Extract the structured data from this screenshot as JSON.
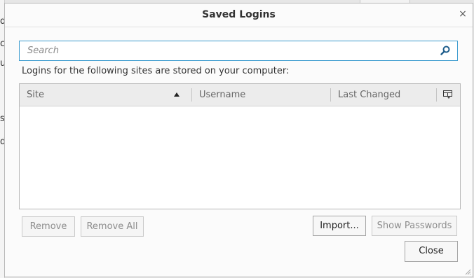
{
  "background": {
    "peek_chars": [
      "d",
      "c",
      "u",
      "s",
      "d"
    ]
  },
  "dialog": {
    "title": "Saved Logins",
    "close_glyph": "×"
  },
  "search": {
    "placeholder": "Search",
    "value": ""
  },
  "description": "Logins for the following sites are stored on your computer:",
  "table": {
    "columns": [
      "Site",
      "Username",
      "Last Changed"
    ],
    "sort_column": "Site",
    "sort_direction": "ascending",
    "rows": []
  },
  "buttons": {
    "remove": "Remove",
    "remove_all": "Remove All",
    "import": "Import...",
    "show_passwords": "Show Passwords",
    "close": "Close"
  },
  "colors": {
    "focus_border": "#3d9ccf",
    "dialog_bg": "#fbfbfb",
    "header_bg": "#ececec"
  }
}
